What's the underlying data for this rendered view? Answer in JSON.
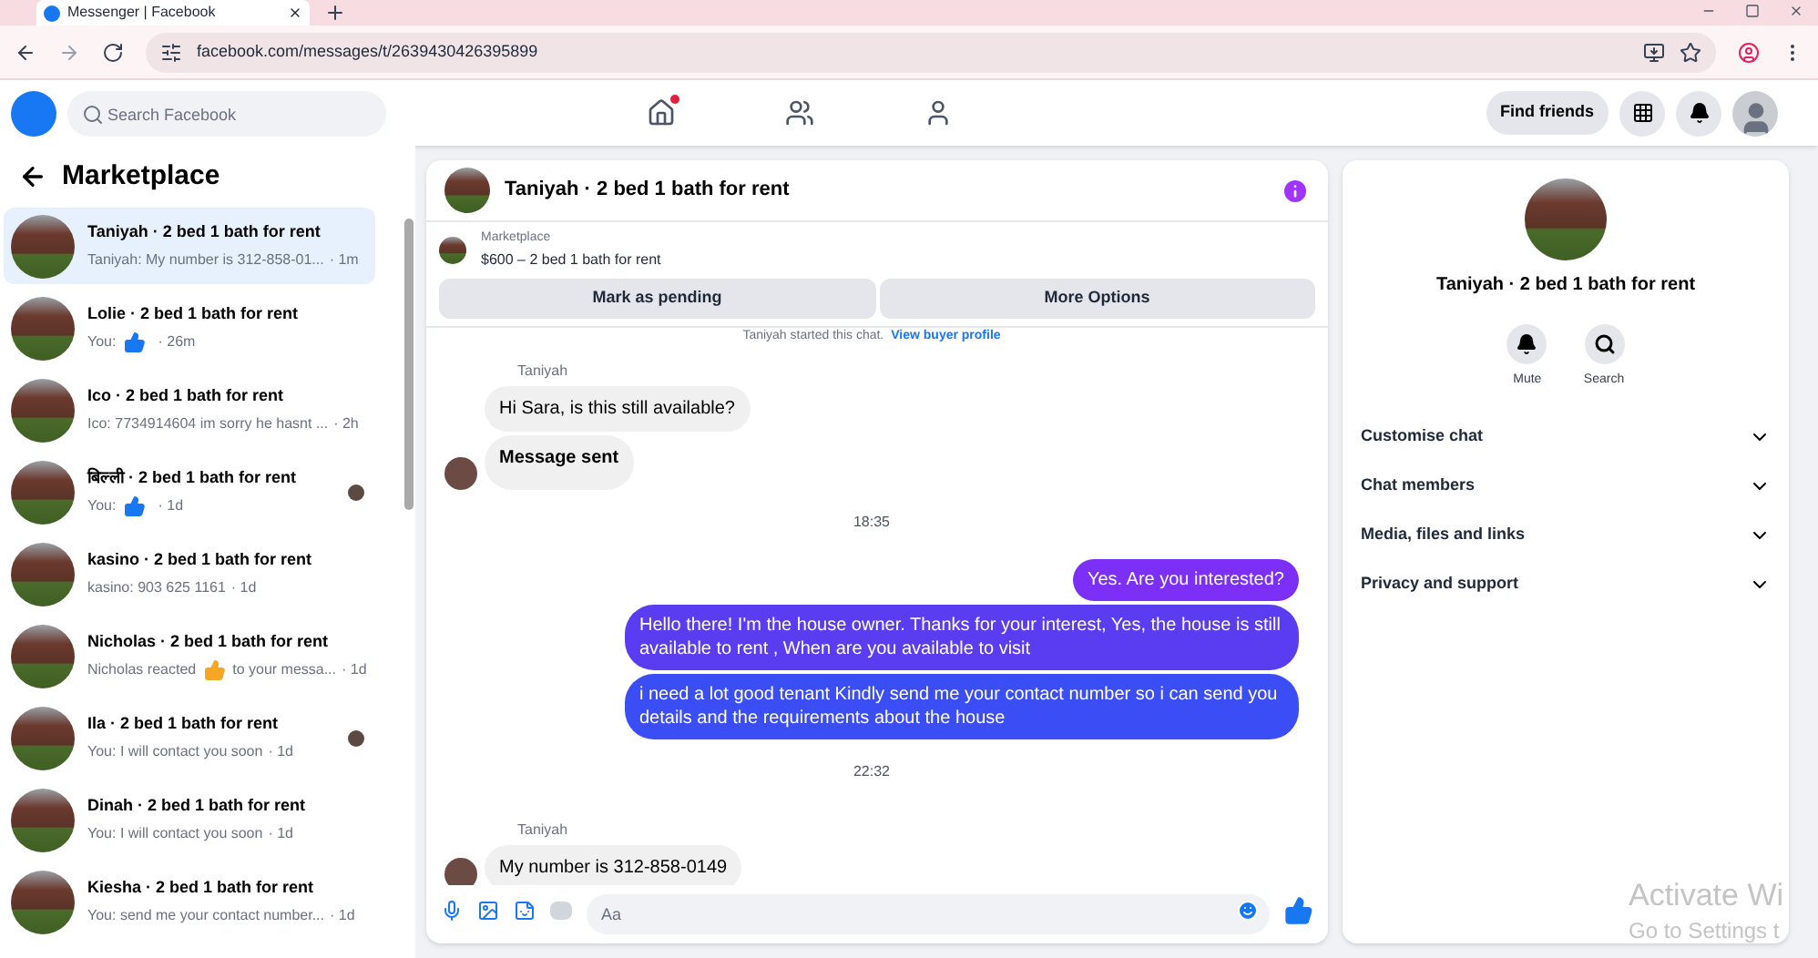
{
  "browser": {
    "tab_title": "Messenger | Facebook",
    "url": "facebook.com/messages/t/2639430426395899"
  },
  "header": {
    "search_placeholder": "Search Facebook",
    "find_friends": "Find friends",
    "home_badge": true
  },
  "sidebar": {
    "title": "Marketplace",
    "items": [
      {
        "title": "Taniyah · 2 bed 1 bath for rent",
        "parts": [
          {
            "kind": "text",
            "text": "Taniyah: My number is 312-858-01..."
          }
        ],
        "time": "· 1m",
        "selected": true,
        "seen": false
      },
      {
        "title": "Lolie · 2 bed 1 bath for rent",
        "parts": [
          {
            "kind": "text",
            "text": "You:"
          },
          {
            "kind": "like"
          }
        ],
        "time": "· 26m",
        "selected": false,
        "seen": false
      },
      {
        "title": "Ico · 2 bed 1 bath for rent",
        "parts": [
          {
            "kind": "text",
            "text": "Ico: 7734914604 im sorry he hasnt ..."
          }
        ],
        "time": "· 2h",
        "selected": false,
        "seen": false
      },
      {
        "title": "बिल्ली · 2 bed 1 bath for rent",
        "parts": [
          {
            "kind": "text",
            "text": "You:"
          },
          {
            "kind": "like"
          }
        ],
        "time": "· 1d",
        "selected": false,
        "seen": true
      },
      {
        "title": "kasino · 2 bed 1 bath for rent",
        "parts": [
          {
            "kind": "text",
            "text": "kasino: 903 625 1161"
          }
        ],
        "time": "· 1d",
        "selected": false,
        "seen": false
      },
      {
        "title": "Nicholas · 2 bed 1 bath for rent",
        "parts": [
          {
            "kind": "text",
            "text": "Nicholas reacted"
          },
          {
            "kind": "thumb"
          },
          {
            "kind": "text",
            "text": "to your messa..."
          }
        ],
        "time": "· 1d",
        "selected": false,
        "seen": false
      },
      {
        "title": "Ila · 2 bed 1 bath for rent",
        "parts": [
          {
            "kind": "text",
            "text": "You: I will contact you soon"
          }
        ],
        "time": "· 1d",
        "selected": false,
        "seen": true
      },
      {
        "title": "Dinah · 2 bed 1 bath for rent",
        "parts": [
          {
            "kind": "text",
            "text": "You: I will contact you soon"
          }
        ],
        "time": "· 1d",
        "selected": false,
        "seen": false
      },
      {
        "title": "Kiesha · 2 bed 1 bath for rent",
        "parts": [
          {
            "kind": "text",
            "text": "You: send me your contact number..."
          }
        ],
        "time": "· 1d",
        "selected": false,
        "seen": false
      }
    ]
  },
  "chat": {
    "title": "Taniyah · 2 bed 1 bath for rent",
    "listing_label": "Marketplace",
    "listing": "$600 – 2 bed 1 bath for rent",
    "buttons": [
      "Mark as pending",
      "More Options"
    ],
    "started": "Taniyah started this chat.",
    "started_link": "View buyer profile",
    "messages": [
      {
        "kind": "sender",
        "text": "Taniyah"
      },
      {
        "kind": "in",
        "text": "Hi Sara, is this still available?",
        "avatar": false
      },
      {
        "kind": "in",
        "text": "Message sent",
        "avatar": true,
        "bold": true
      },
      {
        "kind": "time",
        "text": "18:35"
      },
      {
        "kind": "out",
        "text": "Yes. Are you interested?",
        "color": "#7b2ff7"
      },
      {
        "kind": "out",
        "text": "Hello there! I'm the house owner. Thanks for your interest, Yes, the house is still available to rent , When are you available to visit",
        "color": "#5a3df0"
      },
      {
        "kind": "out",
        "text": "i need a lot good tenant Kindly send me your contact number so i can send you details and the requirements about the house",
        "color": "#3b4ef5"
      },
      {
        "kind": "time",
        "text": "22:32"
      },
      {
        "kind": "sender",
        "text": "Taniyah"
      },
      {
        "kind": "in",
        "text": "My number is 312-858-0149",
        "avatar": true
      }
    ],
    "composer_placeholder": "Aa"
  },
  "details": {
    "title": "Taniyah · 2 bed 1 bath for rent",
    "actions": [
      {
        "kind": "mute",
        "label": "Mute"
      },
      {
        "kind": "search",
        "label": "Search"
      }
    ],
    "sections": [
      {
        "label": "Customise chat",
        "expanded": false
      },
      {
        "label": "Chat members",
        "expanded": false
      },
      {
        "label": "Media, files and links",
        "expanded": false
      },
      {
        "label": "Privacy and support",
        "expanded": false
      }
    ]
  },
  "os_notice": {
    "title": "Activate Wi",
    "subtitle": "Go to Settings t"
  }
}
